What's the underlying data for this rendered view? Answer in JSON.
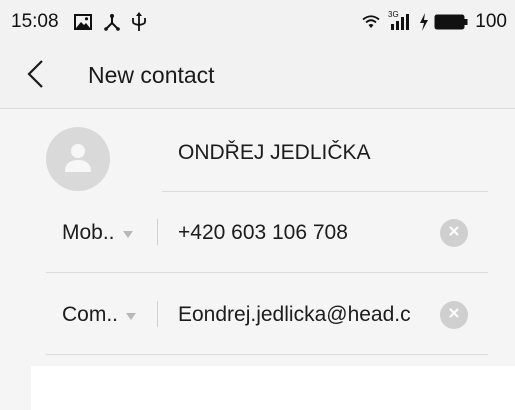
{
  "status_bar": {
    "time": "15:08",
    "network_label": "3G",
    "battery_percent": "100",
    "icons": [
      "image-icon",
      "usb-icon",
      "usb-trident-icon",
      "wifi-icon",
      "signal-icon",
      "charging-bolt-icon",
      "battery-icon"
    ]
  },
  "header": {
    "title": "New contact",
    "back_icon": "chevron-left-icon"
  },
  "contact": {
    "avatar_icon": "person-icon",
    "name": "ONDŘEJ JEDLIČKA"
  },
  "phone": {
    "type_label": "Mob..",
    "value": "+420 603 106 708",
    "clear_icon": "clear-icon"
  },
  "email": {
    "type_label": "Com..",
    "value": "Eondrej.jedlicka@head.c",
    "clear_icon": "clear-icon"
  },
  "colors": {
    "background": "#f5f5f5",
    "header": "#f2f2f2",
    "divider": "#dcdcdc",
    "clear_button": "#cfcfcf"
  }
}
